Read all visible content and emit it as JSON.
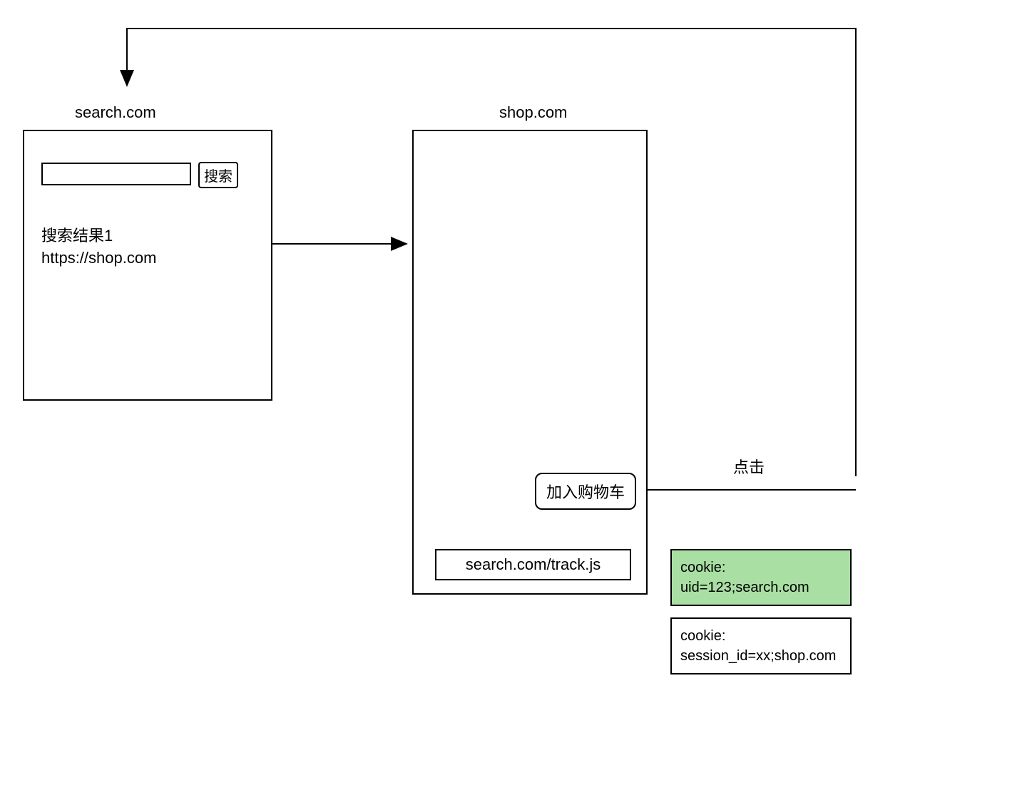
{
  "search_site": {
    "title": "search.com",
    "search_button": "搜索",
    "result_title": "搜索结果1",
    "result_url": "https://shop.com"
  },
  "shop_site": {
    "title": "shop.com",
    "cart_button": "加入购物车",
    "track_script": "search.com/track.js"
  },
  "click_label": "点击",
  "cookie_search": {
    "label": "cookie:",
    "value": "uid=123;search.com"
  },
  "cookie_shop": {
    "label": "cookie:",
    "value": "session_id=xx;shop.com"
  }
}
